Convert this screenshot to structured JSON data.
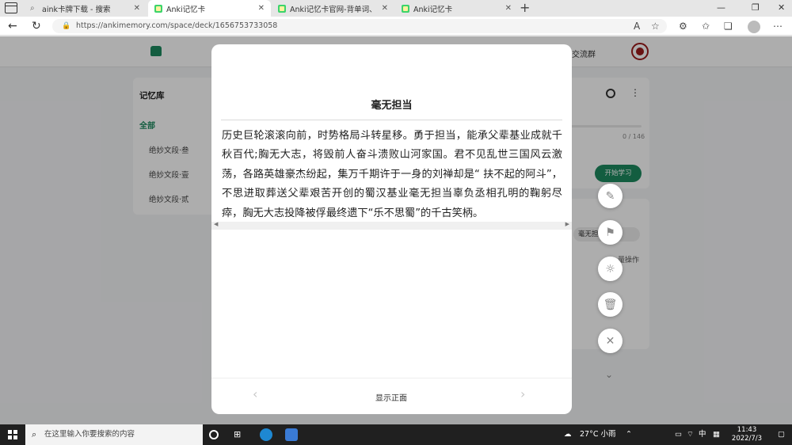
{
  "browser": {
    "tabs": [
      {
        "title": "aink卡牌下载 - 搜索",
        "icon": "search-icon",
        "active": false
      },
      {
        "title": "Anki记忆卡",
        "icon": "anki-favicon",
        "active": true
      },
      {
        "title": "Anki记忆卡官网-背单词、考研、",
        "icon": "anki-favicon",
        "active": false
      },
      {
        "title": "Anki记忆卡",
        "icon": "anki-favicon",
        "active": false
      }
    ],
    "url": "https://ankimemory.com/space/deck/1656753733058"
  },
  "page": {
    "nav_fragment": "交流群",
    "sidebar": {
      "heading": "记忆库",
      "all_label": "全部",
      "decks": [
        "绝妙文段·叁",
        "绝妙文段·壹",
        "绝妙文段·贰"
      ]
    },
    "right": {
      "progress_text": "0 / 146",
      "start_button": "开始学习",
      "pill_fragment": "毫无担",
      "op_fragment": "量操作"
    }
  },
  "card": {
    "title": "毫无担当",
    "body": "历史巨轮滚滚向前，时势格局斗转星移。勇于担当，能承父辈基业成就千秋百代;胸无大志，将毁前人奋斗溃败山河家国。君不见乱世三国风云激荡，各路英雄豪杰纷起，集万千期许于一身的刘禅却是“ 扶不起的阿斗”，不思进取葬送父辈艰苦开创的蜀汉基业毫无担当辜负丞相孔明的鞠躬尽瘁，胸无大志投降被俘最终遗下“乐不思蜀”的千古笑柄。",
    "show_front_label": "显示正面"
  },
  "fabs": [
    "edit-icon",
    "flag-icon",
    "brightness-icon",
    "trash-icon",
    "close-icon"
  ],
  "taskbar": {
    "search_placeholder": "在这里输入你要搜索的内容",
    "weather": "27°C 小雨",
    "ime": "中",
    "time": "11:43",
    "date": "2022/7/3"
  },
  "colors": {
    "accent": "#1d8a5f",
    "overlay": "rgba(0,0,0,0.32)"
  }
}
